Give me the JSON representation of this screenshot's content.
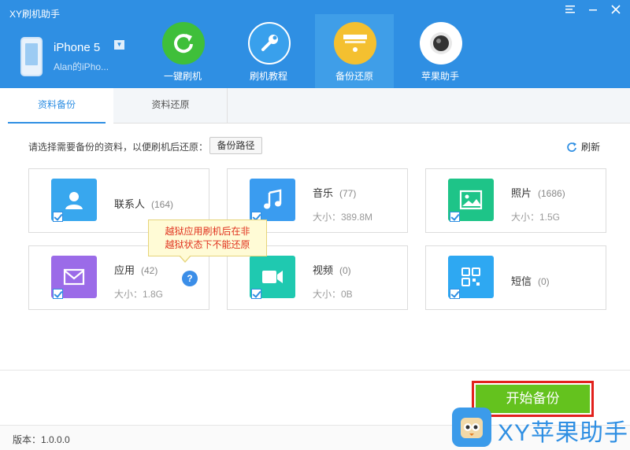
{
  "app": {
    "title": "XY刷机助手"
  },
  "window_controls": [
    {
      "name": "menu-icon",
      "glyph": "☰"
    },
    {
      "name": "minimize-icon",
      "glyph": "─"
    },
    {
      "name": "close-icon",
      "glyph": "✕"
    }
  ],
  "device": {
    "name": "iPhone 5",
    "owner": "Alan的iPho..."
  },
  "nav": [
    {
      "label": "一键刷机",
      "icon": "refresh-icon",
      "color": "#3fbf3a",
      "active": false
    },
    {
      "label": "刷机教程",
      "icon": "wrench-icon",
      "color": "#39a0ec",
      "active": false
    },
    {
      "label": "备份还原",
      "icon": "box-icon",
      "color": "#f4c030",
      "active": true
    },
    {
      "label": "苹果助手",
      "icon": "camera-icon",
      "color": "#ffffff",
      "active": false
    }
  ],
  "tabs": [
    {
      "label": "资料备份",
      "active": true
    },
    {
      "label": "资料还原",
      "active": false
    }
  ],
  "instruction": "请选择需要备份的资料，以便刷机后还原：",
  "path_button": "备份路径",
  "refresh_label": "刷新",
  "items": [
    {
      "name": "联系人",
      "count": "(164)",
      "size": "",
      "icon": "contact-icon",
      "color": "#38a7ee",
      "checked": true
    },
    {
      "name": "音乐",
      "count": "(77)",
      "size": "大小：389.8M",
      "icon": "music-icon",
      "color": "#3a9cf0",
      "checked": true
    },
    {
      "name": "照片",
      "count": "(1686)",
      "size": "大小：1.5G",
      "icon": "photo-icon",
      "color": "#1ec488",
      "checked": true
    },
    {
      "name": "应用",
      "count": "(42)",
      "size": "大小：1.8G",
      "icon": "mail-icon",
      "color": "#9b6be8",
      "checked": true
    },
    {
      "name": "视频",
      "count": "(0)",
      "size": "大小：0B",
      "icon": "video-icon",
      "color": "#1fc9b0",
      "checked": true
    },
    {
      "name": "短信",
      "count": "(0)",
      "size": "",
      "icon": "grid-icon",
      "color": "#2ea8f2",
      "checked": true
    }
  ],
  "tooltip": {
    "line1": "越狱应用刷机后在非",
    "line2": "越狱状态下不能还原"
  },
  "start_button": "开始备份",
  "version": "版本：1.0.0.0",
  "watermark": "XY苹果助手",
  "colors": {
    "header": "#2f8fe3",
    "accent": "#64c21e",
    "highlight": "#e2211c"
  }
}
